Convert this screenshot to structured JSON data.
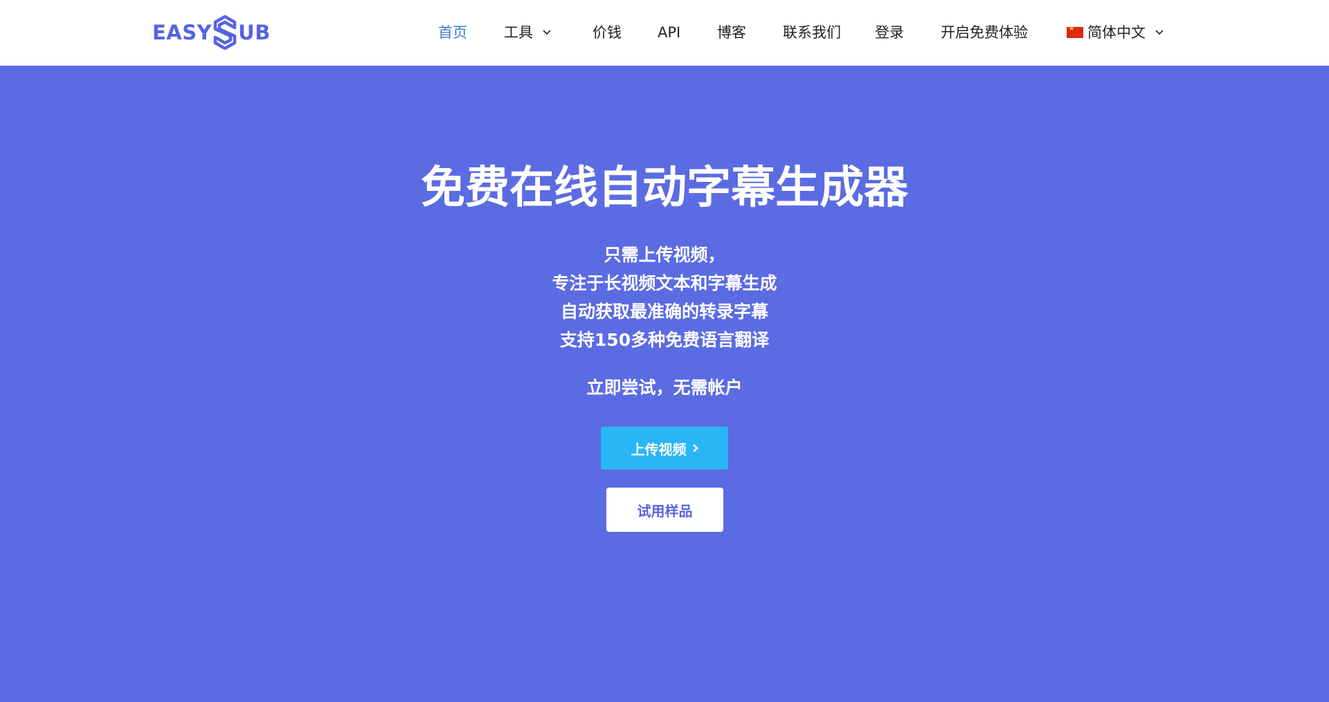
{
  "colors": {
    "brand": "#5663e0",
    "hero_bg": "#5b6be2",
    "nav_active": "#3a7bd5",
    "upload_button": "#29b6f6"
  },
  "logo": {
    "left_text": "EASY",
    "right_text": "UB",
    "mark_icon": "easysub-s-logo-icon"
  },
  "nav": {
    "items": [
      {
        "label": "首页",
        "active": true
      },
      {
        "label": "工具",
        "dropdown": true
      },
      {
        "label": "价钱"
      },
      {
        "label": "API"
      },
      {
        "label": "博客"
      },
      {
        "label": "联系我们"
      },
      {
        "label": "登录"
      },
      {
        "label": "开启免费体验"
      }
    ],
    "language": {
      "label": "简体中文",
      "flag_icon": "china-flag-icon"
    }
  },
  "hero": {
    "title": "免费在线自动字幕生成器",
    "lines": [
      "只需上传视频，",
      "专注于长视频文本和字幕生成",
      "自动获取最准确的转录字幕",
      "支持150多种免费语言翻译"
    ],
    "try_text": "立即尝试，无需帐户",
    "upload_button": "上传视频",
    "sample_button": "试用样品"
  }
}
